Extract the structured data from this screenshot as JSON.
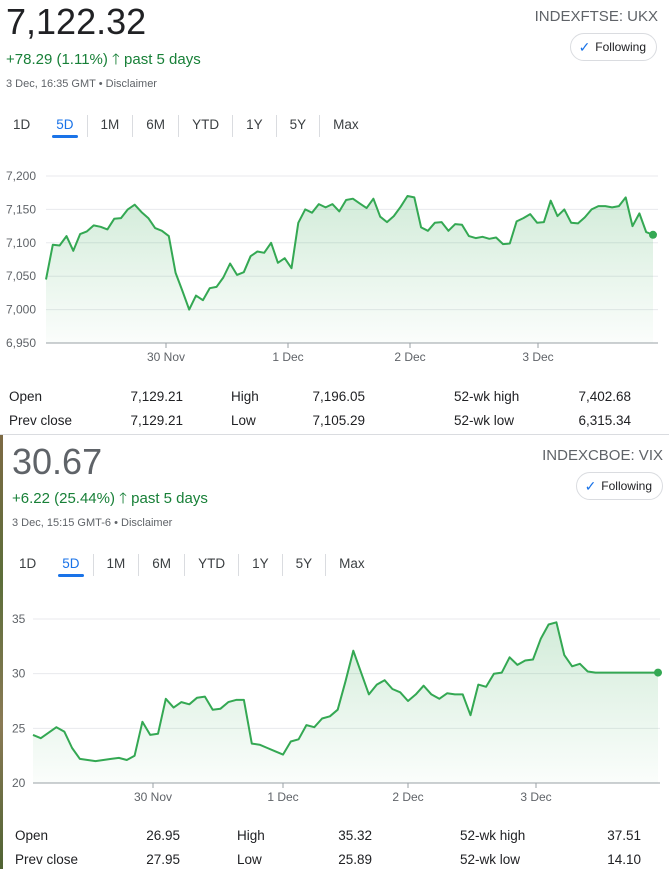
{
  "panels": [
    {
      "price": "7,122.32",
      "ticker": "INDEXFTSE: UKX",
      "follow_label": "Following",
      "change": "+78.29 (1.11%)",
      "change_period": "past 5 days",
      "timestamp": "3 Dec, 16:35 GMT • Disclaimer",
      "ranges": [
        "1D",
        "5D",
        "1M",
        "6M",
        "YTD",
        "1Y",
        "5Y",
        "Max"
      ],
      "selected_range": "5D",
      "stats": [
        {
          "label": "Open",
          "value": "7,129.21"
        },
        {
          "label": "High",
          "value": "7,196.05"
        },
        {
          "label": "52-wk high",
          "value": "7,402.68"
        },
        {
          "label": "Prev close",
          "value": "7,129.21"
        },
        {
          "label": "Low",
          "value": "7,105.29"
        },
        {
          "label": "52-wk low",
          "value": "6,315.34"
        }
      ]
    },
    {
      "price": "30.67",
      "ticker": "INDEXCBOE: VIX",
      "follow_label": "Following",
      "change": "+6.22 (25.44%)",
      "change_period": "past 5 days",
      "timestamp": "3 Dec, 15:15 GMT-6 • Disclaimer",
      "ranges": [
        "1D",
        "5D",
        "1M",
        "6M",
        "YTD",
        "1Y",
        "5Y",
        "Max"
      ],
      "selected_range": "5D",
      "stats": [
        {
          "label": "Open",
          "value": "26.95"
        },
        {
          "label": "High",
          "value": "35.32"
        },
        {
          "label": "52-wk high",
          "value": "37.51"
        },
        {
          "label": "Prev close",
          "value": "27.95"
        },
        {
          "label": "Low",
          "value": "25.89"
        },
        {
          "label": "52-wk low",
          "value": "14.10"
        }
      ]
    }
  ],
  "colors": {
    "line": "#34a853",
    "up": "#188038",
    "accent": "#1a73e8",
    "grid": "#e8eaed"
  },
  "chart_data": [
    {
      "type": "area",
      "title": "",
      "xlabel": "",
      "ylabel": "",
      "x_ticks": [
        "30 Nov",
        "1 Dec",
        "2 Dec",
        "3 Dec"
      ],
      "y_ticks": [
        6950,
        7000,
        7050,
        7100,
        7150,
        7200
      ],
      "ylim": [
        6950,
        7220
      ],
      "grid": true,
      "series": [
        {
          "x": [
            0,
            1,
            2,
            3,
            4,
            5,
            6,
            7,
            8,
            9,
            10,
            11,
            12,
            13,
            14,
            15,
            16,
            17,
            18,
            19,
            20,
            21,
            22,
            23,
            24,
            25,
            26,
            27,
            28,
            29,
            30,
            31,
            32,
            33,
            34,
            35,
            36,
            37,
            38,
            39,
            40,
            41,
            42,
            43,
            44,
            45,
            46,
            47,
            48,
            49,
            50,
            51,
            52,
            53,
            54,
            55,
            56,
            57,
            58,
            59,
            60,
            61,
            62,
            63,
            64,
            65,
            66,
            67,
            68,
            69,
            70,
            71,
            72,
            73,
            74,
            75,
            76,
            77,
            78,
            79,
            80,
            81,
            82,
            83,
            84,
            85,
            86,
            87,
            88,
            89
          ],
          "values": [
            7045,
            7097,
            7096,
            7110,
            7088,
            7113,
            7117,
            7126,
            7124,
            7120,
            7136,
            7137,
            7150,
            7157,
            7146,
            7137,
            7122,
            7118,
            7110,
            7055,
            7028,
            7000,
            7021,
            7014,
            7032,
            7034,
            7048,
            7069,
            7052,
            7056,
            7080,
            7087,
            7085,
            7100,
            7070,
            7077,
            7062,
            7130,
            7150,
            7145,
            7158,
            7153,
            7158,
            7147,
            7164,
            7166,
            7159,
            7152,
            7166,
            7139,
            7131,
            7140,
            7154,
            7170,
            7168,
            7123,
            7118,
            7130,
            7131,
            7118,
            7128,
            7127,
            7110,
            7107,
            7109,
            7106,
            7108,
            7098,
            7099,
            7132,
            7137,
            7143,
            7130,
            7131,
            7163,
            7140,
            7150,
            7130,
            7129,
            7138,
            7150,
            7155,
            7155,
            7153,
            7155,
            7168,
            7125,
            7144,
            7116,
            7112
          ]
        }
      ]
    },
    {
      "type": "area",
      "title": "",
      "xlabel": "",
      "ylabel": "",
      "x_ticks": [
        "30 Nov",
        "1 Dec",
        "2 Dec",
        "3 Dec"
      ],
      "y_ticks": [
        20,
        25,
        30,
        35
      ],
      "ylim": [
        20,
        36
      ],
      "grid": true,
      "series": [
        {
          "x": [
            0,
            1,
            2,
            3,
            4,
            5,
            6,
            7,
            8,
            9,
            10,
            11,
            12,
            13,
            14,
            15,
            16,
            17,
            18,
            19,
            20,
            21,
            22,
            23,
            24,
            25,
            26,
            27,
            28,
            29,
            30,
            31,
            32,
            33,
            34,
            35,
            36,
            37,
            38,
            39,
            40,
            41,
            42,
            43,
            44,
            45,
            46,
            47,
            48,
            49,
            50,
            51,
            52,
            53,
            54,
            55,
            56,
            57,
            58,
            59,
            60,
            61,
            62,
            63,
            64,
            65,
            66,
            67,
            68,
            69,
            70,
            71,
            72,
            73,
            74,
            75,
            76,
            77,
            78,
            79,
            80
          ],
          "values": [
            24.4,
            24.1,
            24.6,
            25.1,
            24.7,
            23.2,
            22.2,
            22.1,
            22.0,
            22.1,
            22.2,
            22.3,
            22.1,
            22.5,
            25.6,
            24.4,
            24.5,
            27.7,
            26.9,
            27.4,
            27.2,
            27.8,
            27.9,
            26.7,
            26.8,
            27.4,
            27.6,
            27.6,
            23.6,
            23.5,
            23.2,
            22.9,
            22.6,
            23.8,
            24.0,
            25.3,
            25.1,
            25.9,
            26.1,
            26.7,
            29.3,
            32.1,
            30.1,
            28.1,
            29.0,
            29.4,
            28.6,
            28.3,
            27.5,
            28.1,
            28.9,
            28.1,
            27.7,
            28.2,
            28.1,
            28.1,
            26.2,
            29.0,
            28.8,
            30.0,
            30.1,
            31.5,
            30.8,
            31.2,
            31.3,
            33.2,
            34.5,
            34.7,
            31.7,
            30.67,
            30.9,
            30.2,
            30.1,
            30.1,
            30.1,
            30.1,
            30.1,
            30.1,
            30.1,
            30.1,
            30.1
          ]
        }
      ]
    }
  ]
}
